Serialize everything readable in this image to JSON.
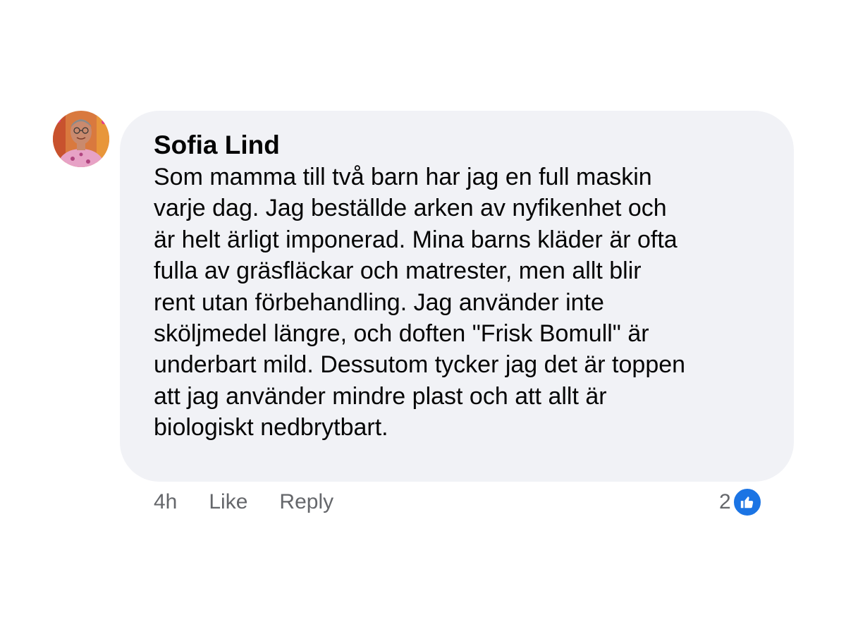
{
  "comment": {
    "author": "Sofia Lind",
    "lines": [
      "Som mamma till två barn har jag en full maskin",
      "varje dag. Jag beställde arken av nyfikenhet och",
      "är helt ärligt imponerad. Mina barns kläder är ofta",
      "fulla av gräsfläckar och matrester, men allt blir",
      "rent utan förbehandling. Jag använder inte",
      "sköljmedel längre, och doften \"Frisk Bomull\" är",
      "underbart mild. Dessutom tycker jag det är toppen",
      "att jag använder mindre plast och att allt är",
      "biologiskt nedbrytbart."
    ]
  },
  "actions": {
    "timestamp": "4h",
    "like_label": "Like",
    "reply_label": "Reply"
  },
  "reactions": {
    "count": "2",
    "icon": "thumbs-up-icon",
    "badge_color": "#1b74e4"
  },
  "colors": {
    "bubble_bg": "#f1f2f6",
    "secondary_text": "#65676b",
    "primary_text": "#050505"
  }
}
